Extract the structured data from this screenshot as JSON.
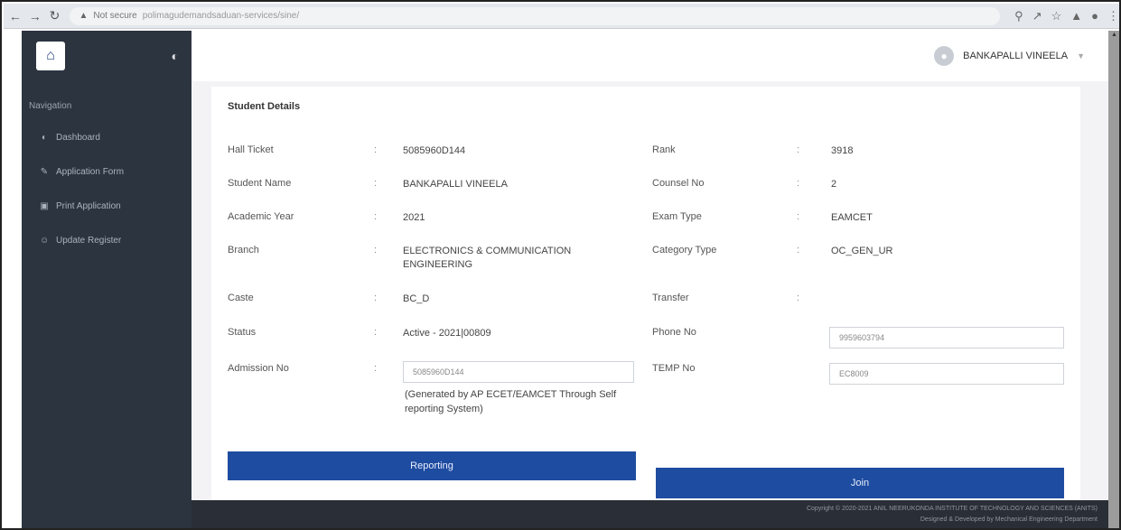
{
  "browser": {
    "security_label": "Not secure",
    "url": "polimagudemandsaduan-services/sine/"
  },
  "sidebar": {
    "heading": "Navigation",
    "items": [
      {
        "label": "Dashboard",
        "icon": "dashboard-icon"
      },
      {
        "label": "Application Form",
        "icon": "form-icon"
      },
      {
        "label": "Print Application",
        "icon": "print-icon"
      },
      {
        "label": "Update Register",
        "icon": "user-icon"
      }
    ]
  },
  "header": {
    "user_name": "BANKAPALLI VINEELA"
  },
  "card": {
    "title": "Student Details",
    "left": [
      {
        "label": "Hall Ticket",
        "value": "5085960D144"
      },
      {
        "label": "Student Name",
        "value": "BANKAPALLI VINEELA"
      },
      {
        "label": "Academic Year",
        "value": "2021"
      },
      {
        "label": "Branch",
        "value": "ELECTRONICS & COMMUNICATION ENGINEERING"
      },
      {
        "label": "Caste",
        "value": "BC_D"
      },
      {
        "label": "Status",
        "value": "Active - 2021|00809"
      },
      {
        "label": "Admission No",
        "value": ""
      }
    ],
    "right": [
      {
        "label": "Rank",
        "value": "3918"
      },
      {
        "label": "Counsel No",
        "value": "2"
      },
      {
        "label": "Exam Type",
        "value": "EAMCET"
      },
      {
        "label": "Category Type",
        "value": "OC_GEN_UR"
      },
      {
        "label": "Transfer",
        "value": ""
      },
      {
        "label": "Phone No",
        "value": ""
      },
      {
        "label": "TEMP No",
        "value": ""
      }
    ],
    "admission_input_value": "5085960D144",
    "admission_note": "(Generated by AP ECET/EAMCET Through Self reporting System)",
    "phone_input_value": "9959603794",
    "temp_input_value": "EC8009",
    "reporting_button": "Reporting",
    "join_button": "Join"
  },
  "footer": {
    "line1": "Copyright © 2020-2021 ANIL NEERUKONDA INSTITUTE OF TECHNOLOGY AND SCIENCES (ANITS)",
    "line2": "Designed & Developed by Mechanical Engineering Department"
  }
}
